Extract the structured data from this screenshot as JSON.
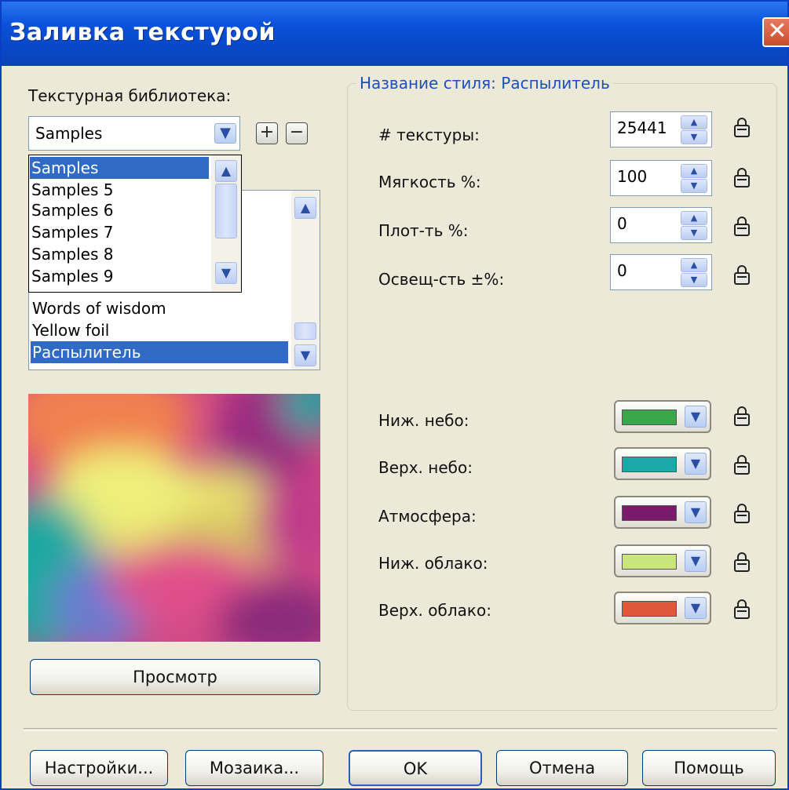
{
  "window": {
    "title": "Заливка текстурой",
    "close_glyph": "✕"
  },
  "library": {
    "label": "Текстурная библиотека:",
    "selected": "Samples",
    "dropdown_items": [
      "Samples",
      "Samples 5",
      "Samples 6",
      "Samples 7",
      "Samples 8",
      "Samples 9"
    ],
    "dropdown_selected_index": 0
  },
  "texture_list": {
    "items": [
      "Words of wisdom",
      "Yellow foil",
      "Распылитель"
    ],
    "selected": "Распылитель"
  },
  "buttons": {
    "preview": "Просмотр",
    "settings": "Настройки...",
    "mosaic": "Мозаика...",
    "ok": "OK",
    "cancel": "Отмена",
    "help": "Помощь",
    "add": "+",
    "remove": "−"
  },
  "style": {
    "group_title": "Название стиля: Распылитель",
    "params": [
      {
        "label": "# текстуры:",
        "value": "25441"
      },
      {
        "label": "Мягкость %:",
        "value": "100"
      },
      {
        "label": "Плот-ть %:",
        "value": "0"
      },
      {
        "label": "Освещ-сть ±%:",
        "value": "0"
      }
    ],
    "colors": [
      {
        "label": "Ниж. небо:",
        "color": "#3aa84a"
      },
      {
        "label": "Верх. небо:",
        "color": "#1aa8a8"
      },
      {
        "label": "Атмосфера:",
        "color": "#7a1a6a"
      },
      {
        "label": "Ниж. облако:",
        "color": "#c9e67a"
      },
      {
        "label": "Верх. облако:",
        "color": "#e0583a"
      }
    ]
  },
  "icons": {
    "lock": "lock-icon",
    "spin_up": "▲",
    "spin_down": "▼",
    "combo_arrow": "▼",
    "scroll_up": "▲",
    "scroll_down": "▼"
  }
}
